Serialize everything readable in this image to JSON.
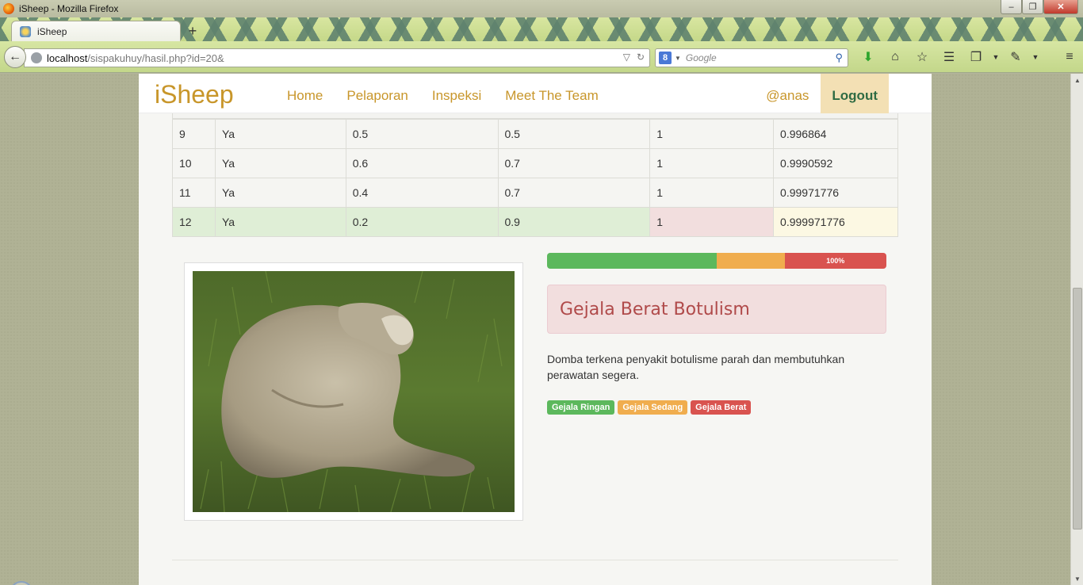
{
  "window": {
    "title": "iSheep - Mozilla Firefox"
  },
  "browser": {
    "tab_title": "iSheep",
    "new_tab": "+",
    "url_host": "localhost",
    "url_path": "/sispakuhuy/hasil.php?id=20&",
    "search_engine": "8",
    "search_placeholder": "Google"
  },
  "site": {
    "brand": "iSheep",
    "nav": [
      "Home",
      "Pelaporan",
      "Inspeksi",
      "Meet The Team"
    ],
    "user": "@anas",
    "logout": "Logout"
  },
  "table": {
    "rows": [
      [
        "9",
        "Ya",
        "0.5",
        "0.5",
        "1",
        "0.996864"
      ],
      [
        "10",
        "Ya",
        "0.6",
        "0.7",
        "1",
        "0.9990592"
      ],
      [
        "11",
        "Ya",
        "0.4",
        "0.7",
        "1",
        "0.99971776"
      ],
      [
        "12",
        "Ya",
        "0.2",
        "0.9",
        "1",
        "0.999971776"
      ]
    ]
  },
  "result": {
    "progress": [
      {
        "name": "ringan",
        "percent": 50,
        "color": "#5cb85c",
        "label": ""
      },
      {
        "name": "sedang",
        "percent": 20,
        "color": "#f0ad4e",
        "label": ""
      },
      {
        "name": "berat",
        "percent": 30,
        "color": "#d9534f",
        "label": "100%"
      }
    ],
    "title": "Gejala Berat Botulism",
    "description": "Domba terkena penyakit botulisme parah dan membutuhkan perawatan segera.",
    "labels": [
      {
        "text": "Gejala Ringan",
        "color": "#5cb85c"
      },
      {
        "text": "Gejala Sedang",
        "color": "#f0ad4e"
      },
      {
        "text": "Gejala Berat",
        "color": "#d9534f"
      }
    ]
  }
}
